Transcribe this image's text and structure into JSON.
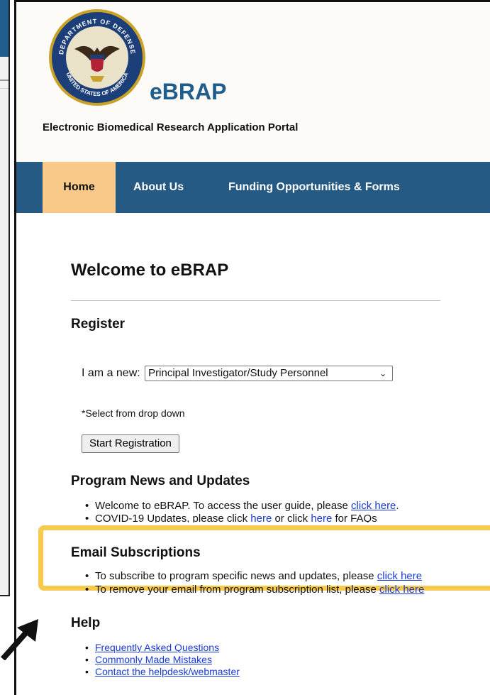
{
  "brand": {
    "name": "eBRAP",
    "tagline": "Electronic Biomedical Research Application Portal",
    "seal_text_top": "DEPARTMENT OF DEFENSE",
    "seal_text_bottom": "UNITED STATES OF AMERICA"
  },
  "nav": {
    "items": [
      {
        "label": "Home"
      },
      {
        "label": "About Us"
      },
      {
        "label": "Funding Opportunities & Forms"
      }
    ]
  },
  "welcome": {
    "title": "Welcome to eBRAP"
  },
  "register": {
    "heading": "Register",
    "role_label": "I am a new:",
    "role_selected": "Principal Investigator/Study Personnel",
    "hint": "*Select from drop down",
    "start_button": "Start Registration"
  },
  "news": {
    "heading": "Program News and Updates",
    "item1_text": "Welcome to eBRAP. To access the user guide, please ",
    "item1_link": "click here",
    "item1_end": ".",
    "item2_text": "COVID-19 Updates, please click ",
    "item2_link1": "here",
    "item2_mid": " or click ",
    "item2_link2": "here",
    "item2_end": " for FAQs"
  },
  "email": {
    "heading": "Email Subscriptions",
    "item1_text": "To subscribe to program specific news and updates, please ",
    "item1_link": "click here",
    "item2_text": "To remove your email from program subscription list, please ",
    "item2_link": "click here"
  },
  "help": {
    "heading": "Help",
    "links": [
      "Frequently Asked Questions",
      "Commonly Made Mistakes",
      "Contact the helpdesk/webmaster"
    ]
  },
  "colors": {
    "nav_bg": "#245a84",
    "nav_active": "#f9c98a",
    "brand": "#1f5d8c",
    "link": "#1a3bd6",
    "highlight": "#f7c94c"
  },
  "icons": {
    "seal": "dod-seal-icon",
    "dropdown": "chevron-down-icon",
    "annotation": "arrow-icon"
  }
}
